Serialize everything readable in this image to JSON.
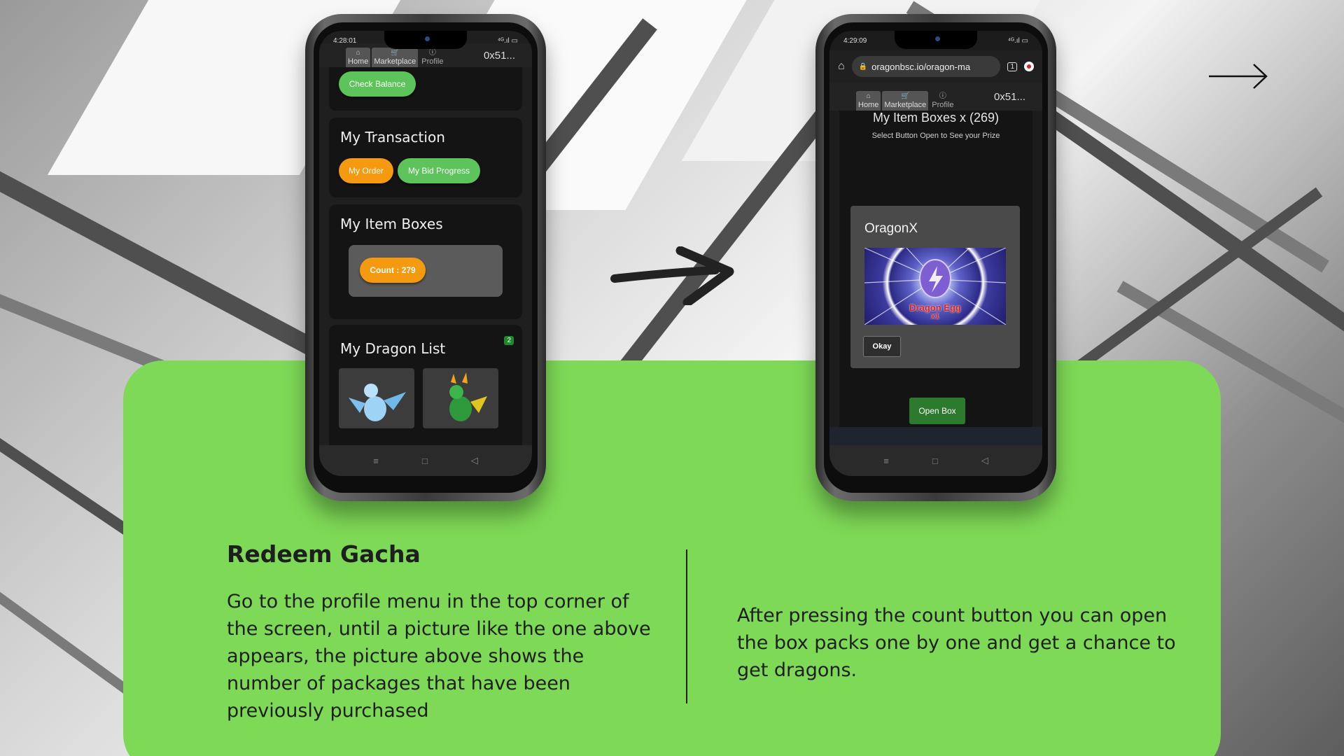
{
  "slide": {
    "title": "Redeem Gacha",
    "left_text": "Go to the profile menu in the top corner of the screen, until a picture like the one above appears, the picture above shows the number of packages that have been previously purchased",
    "right_text": "After pressing the count button you can open the box packs one by one and get a chance to get dragons.",
    "accent_color": "#7ed957"
  },
  "phone_left": {
    "status_time": "4:28:01",
    "status_icons": "⁴ᴳ.ıl ▭",
    "nav": {
      "home": "Home",
      "marketplace": "Marketplace",
      "profile": "Profile",
      "address": "0x51..."
    },
    "check_balance": "Check Balance",
    "transaction": {
      "title": "My Transaction",
      "my_order": "My Order",
      "my_bid_progress": "My Bid Progress"
    },
    "item_boxes": {
      "title": "My Item Boxes",
      "count_button": "Count : 279"
    },
    "dragon_list": {
      "title": "My Dragon List",
      "badge": "2"
    },
    "system_nav": {
      "menu": "≡",
      "home": "□",
      "back": "◁"
    }
  },
  "phone_right": {
    "status_time": "4:29:09",
    "status_icons": "⁴ᴳ.ıl ▭",
    "url": "oragonbsc.io/oragon-ma",
    "tab_count": "1",
    "nav": {
      "home": "Home",
      "marketplace": "Marketplace",
      "profile": "Profile",
      "address": "0x51..."
    },
    "boxes_title": "My Item Boxes x (269)",
    "boxes_subtitle": "Select Button Open to See your Prize",
    "modal": {
      "title": "OragonX",
      "prize_label": "Dragon Egg",
      "prize_qty": "x1",
      "okay": "Okay"
    },
    "open_box": "Open Box",
    "system_nav": {
      "menu": "≡",
      "home": "□",
      "back": "◁"
    }
  }
}
